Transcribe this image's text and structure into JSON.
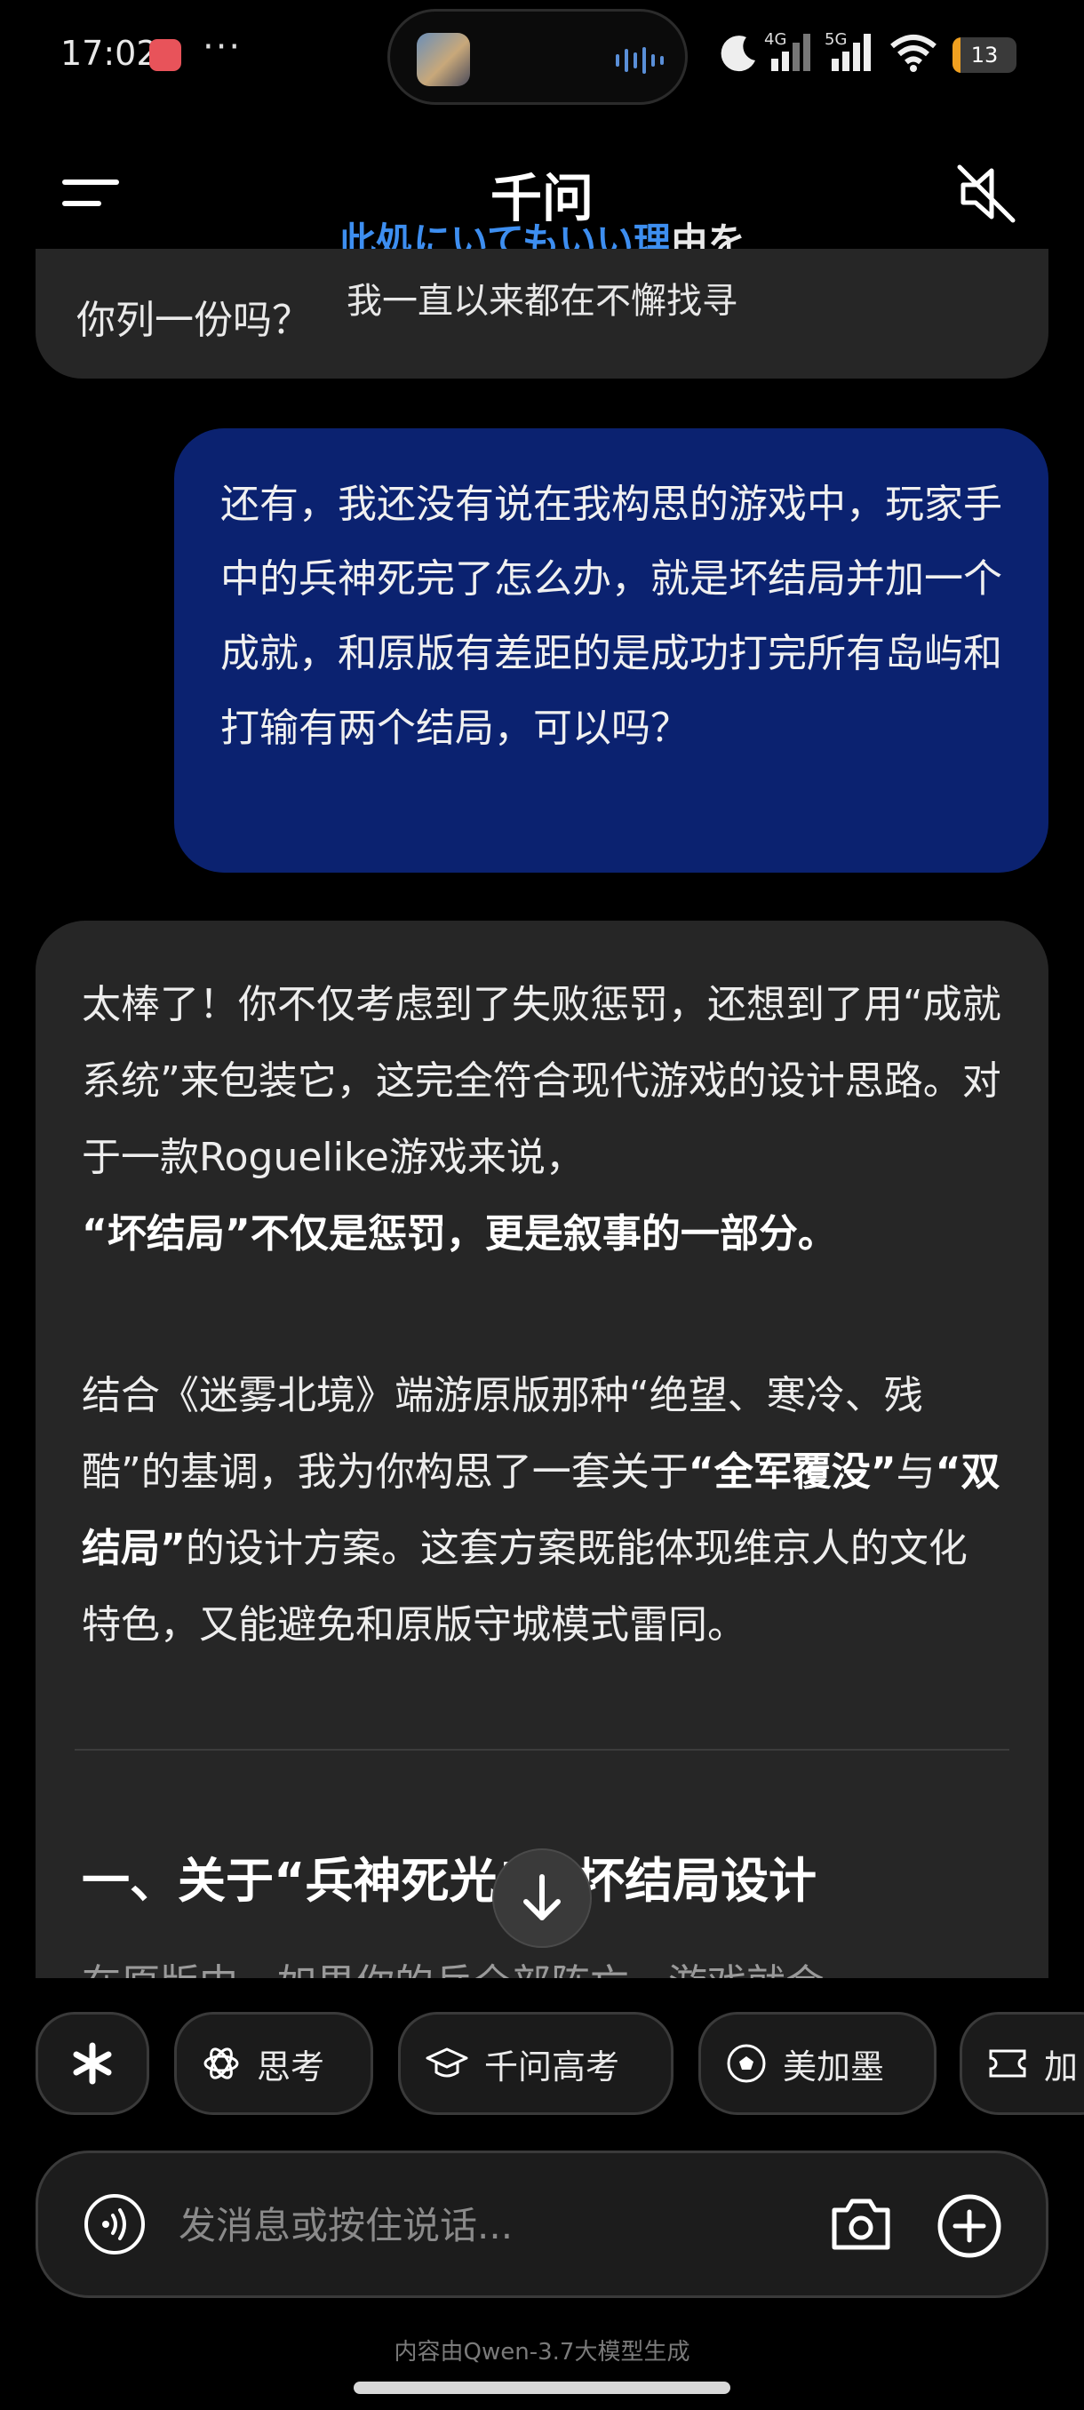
{
  "status_bar": {
    "time": "17:02",
    "more": "···",
    "network1": "4G",
    "network2": "5G",
    "battery": "13",
    "battery_level": 0.13
  },
  "header": {
    "title": "千问",
    "lyric_blue": "此処にいてもいい理",
    "lyric_white": "由を",
    "lyric_line2": "我一直以来都在不懈找寻"
  },
  "messages": {
    "prev_tail": "你列一份吗？",
    "user": "还有，我还没有说在我构思的游戏中，玩家手中的兵神死完了怎么办，就是坏结局并加一个成就，和原版有差距的是成功打完所有岛屿和打输有两个结局，可以吗？",
    "ai": {
      "p1_part1": "太棒了！你不仅考虑到了失败惩罚，还想到了用“成就系统”来包装它，这完全符合现代游戏的设计思路。对于一款Roguelike游戏来说，",
      "p1_bold": "“坏结局”不仅是惩罚，更是叙事的一部分。",
      "p2_part1": "结合《迷雾北境》端游原版那种“绝望、寒冷、残酷”的基调，我为你构思了一套关于",
      "p2_bold1": "“全军覆没”",
      "p2_mid": "与",
      "p2_bold2": "“双结局”",
      "p2_part2": "的设计方案。这套方案既能体现维京人的文化特色，又能避免和原版守城模式雷同。",
      "heading": "一、关于“兵神死光”的坏结局设计",
      "partial": "在原版中，如果你的兵全部阵亡，游戏就会"
    }
  },
  "chips": [
    "思考",
    "千问高考",
    "美加墨",
    "加"
  ],
  "input": {
    "placeholder": "发消息或按住说话..."
  },
  "footer": "内容由Qwen-3.7大模型生成"
}
